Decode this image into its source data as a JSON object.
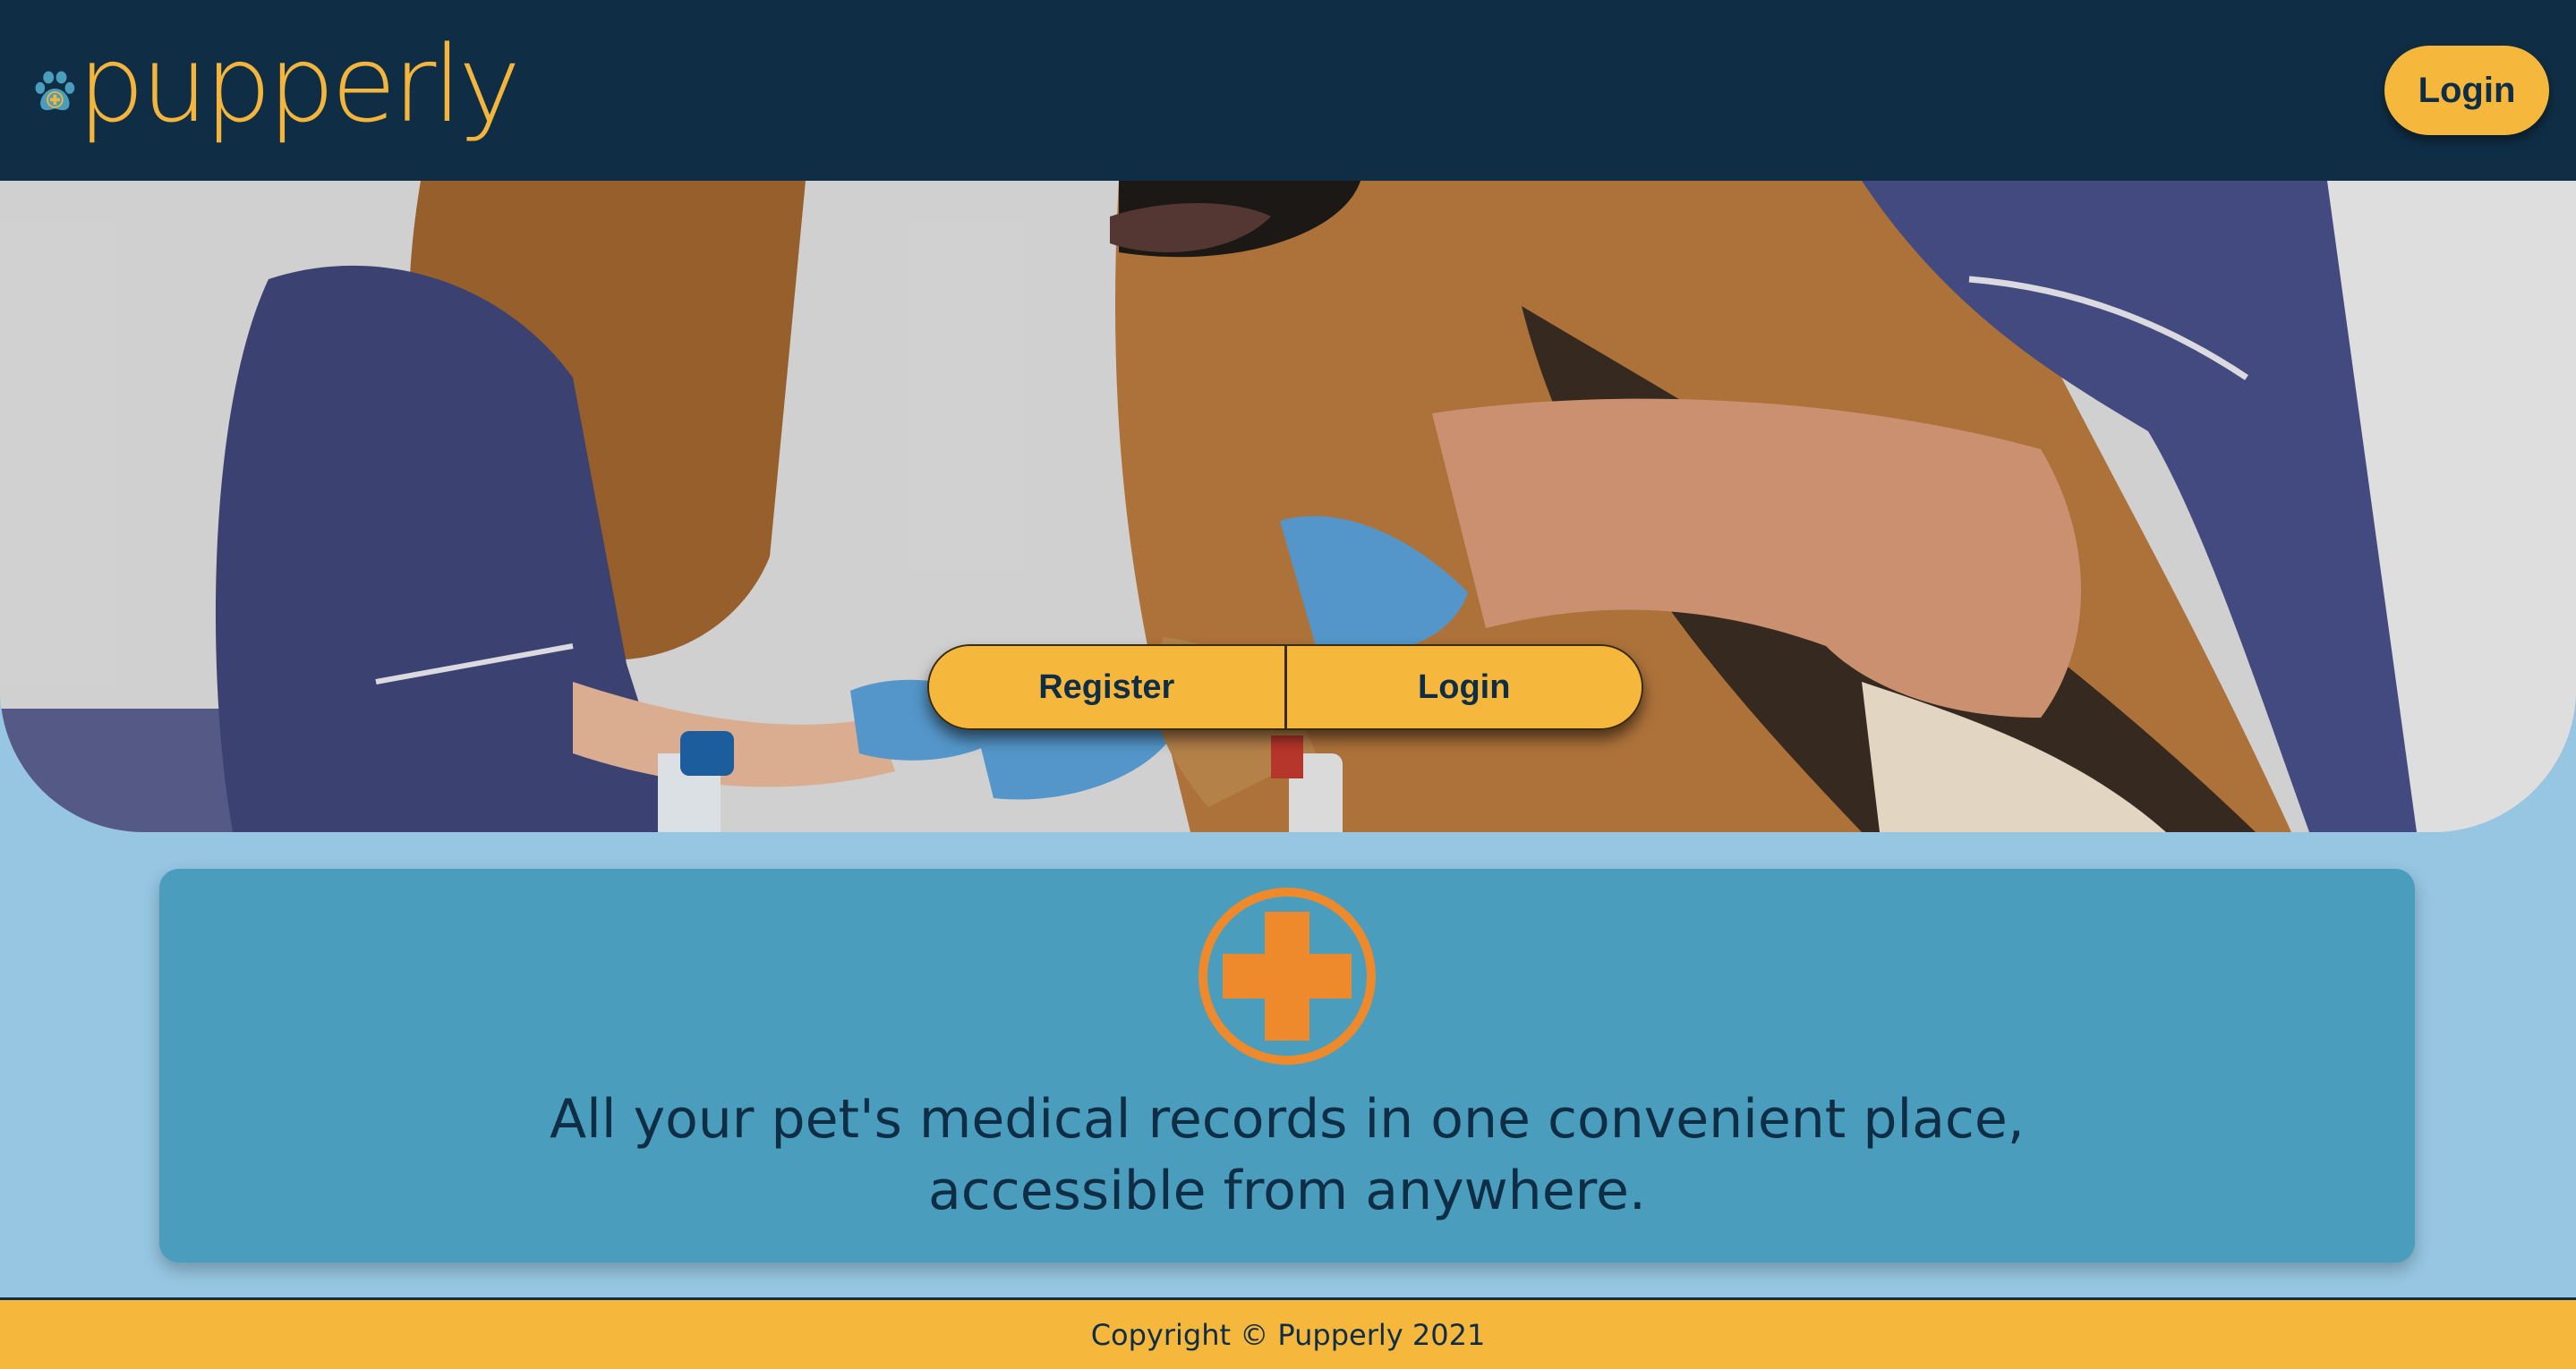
{
  "header": {
    "logo_text": "pupperly",
    "login_label": "Login"
  },
  "hero": {
    "register_label": "Register",
    "login_label": "Login"
  },
  "info": {
    "icon": "medical-cross-icon",
    "tagline_line1": "All your pet's medical records in one convenient place,",
    "tagline_line2": "accessible from anywhere."
  },
  "footer": {
    "copyright": "Copyright © Pupperly 2021"
  },
  "colors": {
    "navy": "#0f2e46",
    "accent_yellow": "#f6b73d",
    "page_blue": "#96c6e2",
    "card_blue": "#4a9dbc",
    "cross_orange": "#ee8a2c",
    "paw_blue": "#4a9dbc"
  }
}
